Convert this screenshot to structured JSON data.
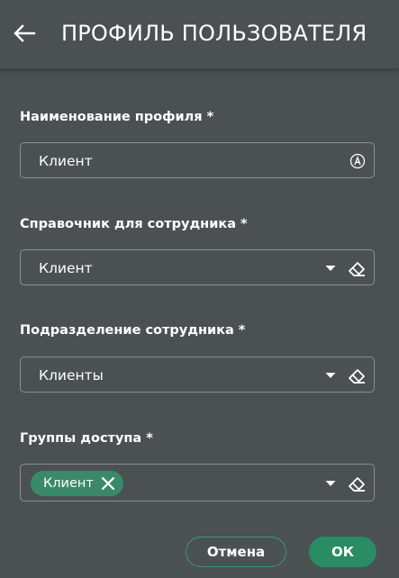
{
  "header": {
    "title": "ПРОФИЛЬ ПОЛЬЗОВАТЕЛЯ",
    "back_icon": "arrow-left-icon"
  },
  "form": {
    "profile_name": {
      "label": "Наименование профиля *",
      "value": "Клиент",
      "icon": "auto-a-circle-icon"
    },
    "employee_directory": {
      "label": "Справочник для сотрудника *",
      "value": "Клиент",
      "icons": [
        "dropdown-triangle-icon",
        "eraser-icon"
      ]
    },
    "employee_department": {
      "label": "Подразделение сотрудника *",
      "value": "Клиенты",
      "icons": [
        "dropdown-triangle-icon",
        "eraser-icon"
      ]
    },
    "access_groups": {
      "label": "Группы доступа *",
      "chips": [
        {
          "label": "Клиент"
        }
      ],
      "icons": [
        "dropdown-triangle-icon",
        "eraser-icon"
      ]
    }
  },
  "actions": {
    "cancel_label": "Отмена",
    "ok_label": "ОК"
  },
  "colors": {
    "background": "#4b5153",
    "field_border": "#8a9092",
    "chip_background": "#3a8a6a",
    "primary_button": "#2a8c63",
    "outline_button_border": "#3a9a72"
  }
}
